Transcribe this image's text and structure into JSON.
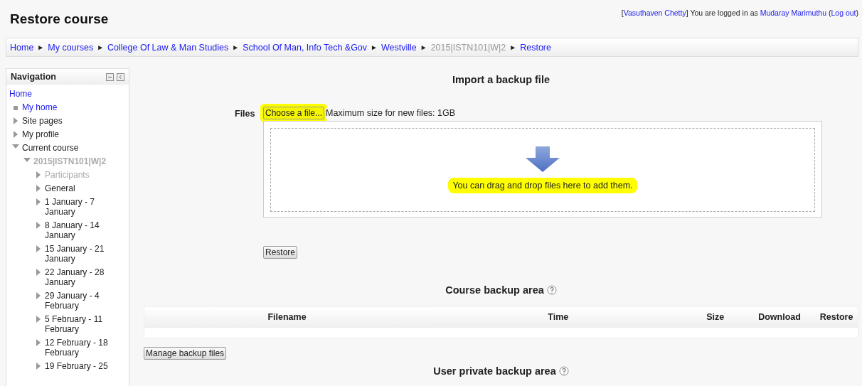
{
  "header": {
    "title": "Restore course",
    "login": {
      "brackets": [
        "[",
        "]",
        "(",
        ")"
      ],
      "user_link": "Vasuthaven Chetty",
      "text": "You are logged in as",
      "real_user": "Mudaray Marimuthu",
      "logout": "Log out"
    }
  },
  "breadcrumb": [
    {
      "label": "Home",
      "link": true
    },
    {
      "label": "My courses",
      "link": true
    },
    {
      "label": "College Of Law & Man Studies",
      "link": true
    },
    {
      "label": "School Of Man, Info Tech &Gov",
      "link": true
    },
    {
      "label": "Westville",
      "link": true
    },
    {
      "label": "2015|ISTN101|W|2",
      "link": false
    },
    {
      "label": "Restore",
      "link": true
    }
  ],
  "breadcrumb_separator": "►",
  "navigation": {
    "title": "Navigation",
    "items": [
      {
        "label": "Home",
        "kind": "root",
        "link": true,
        "dimmed": false
      },
      {
        "label": "My home",
        "kind": "leaf",
        "link": true,
        "dimmed": false
      },
      {
        "label": "Site pages",
        "kind": "branch",
        "expanded": false,
        "link": false,
        "dimmed": false
      },
      {
        "label": "My profile",
        "kind": "branch",
        "expanded": false,
        "link": false,
        "dimmed": false
      },
      {
        "label": "Current course",
        "kind": "branch",
        "expanded": true,
        "link": false,
        "dimmed": false,
        "children": [
          {
            "label": "2015|ISTN101|W|2",
            "kind": "branch",
            "expanded": true,
            "dimmed": true,
            "bold": true,
            "children": [
              {
                "label": "Participants",
                "kind": "branch",
                "expanded": false,
                "dimmed": true
              },
              {
                "label": "General",
                "kind": "branch",
                "expanded": false,
                "link": false,
                "dimmed": false
              },
              {
                "label": "1 January - 7 January",
                "kind": "branch",
                "expanded": false,
                "link": false,
                "dimmed": false
              },
              {
                "label": "8 January - 14 January",
                "kind": "branch",
                "expanded": false,
                "link": false,
                "dimmed": false
              },
              {
                "label": "15 January - 21 January",
                "kind": "branch",
                "expanded": false,
                "link": false,
                "dimmed": false
              },
              {
                "label": "22 January - 28 January",
                "kind": "branch",
                "expanded": false,
                "link": false,
                "dimmed": false
              },
              {
                "label": "29 January - 4 February",
                "kind": "branch",
                "expanded": false,
                "link": false,
                "dimmed": false
              },
              {
                "label": "5 February - 11 February",
                "kind": "branch",
                "expanded": false,
                "link": false,
                "dimmed": false
              },
              {
                "label": "12 February - 18 February",
                "kind": "branch",
                "expanded": false,
                "link": false,
                "dimmed": false
              },
              {
                "label": "19 February - 25",
                "kind": "branch",
                "expanded": false,
                "link": false,
                "dimmed": false
              }
            ]
          }
        ]
      }
    ]
  },
  "import": {
    "title": "Import a backup file",
    "files_label": "Files",
    "choose_button": {
      "label": "Choose a file...",
      "highlighted": true
    },
    "max_size": "Maximum size for new files: 1GB",
    "drop_hint": {
      "text": "You can drag and drop files here to add them.",
      "highlighted": true
    },
    "restore_button": "Restore"
  },
  "course_backup": {
    "title": "Course backup area",
    "columns": [
      "Filename",
      "Time",
      "Size",
      "Download",
      "Restore"
    ],
    "manage_button": "Manage backup files"
  },
  "user_backup": {
    "title": "User private backup area"
  }
}
